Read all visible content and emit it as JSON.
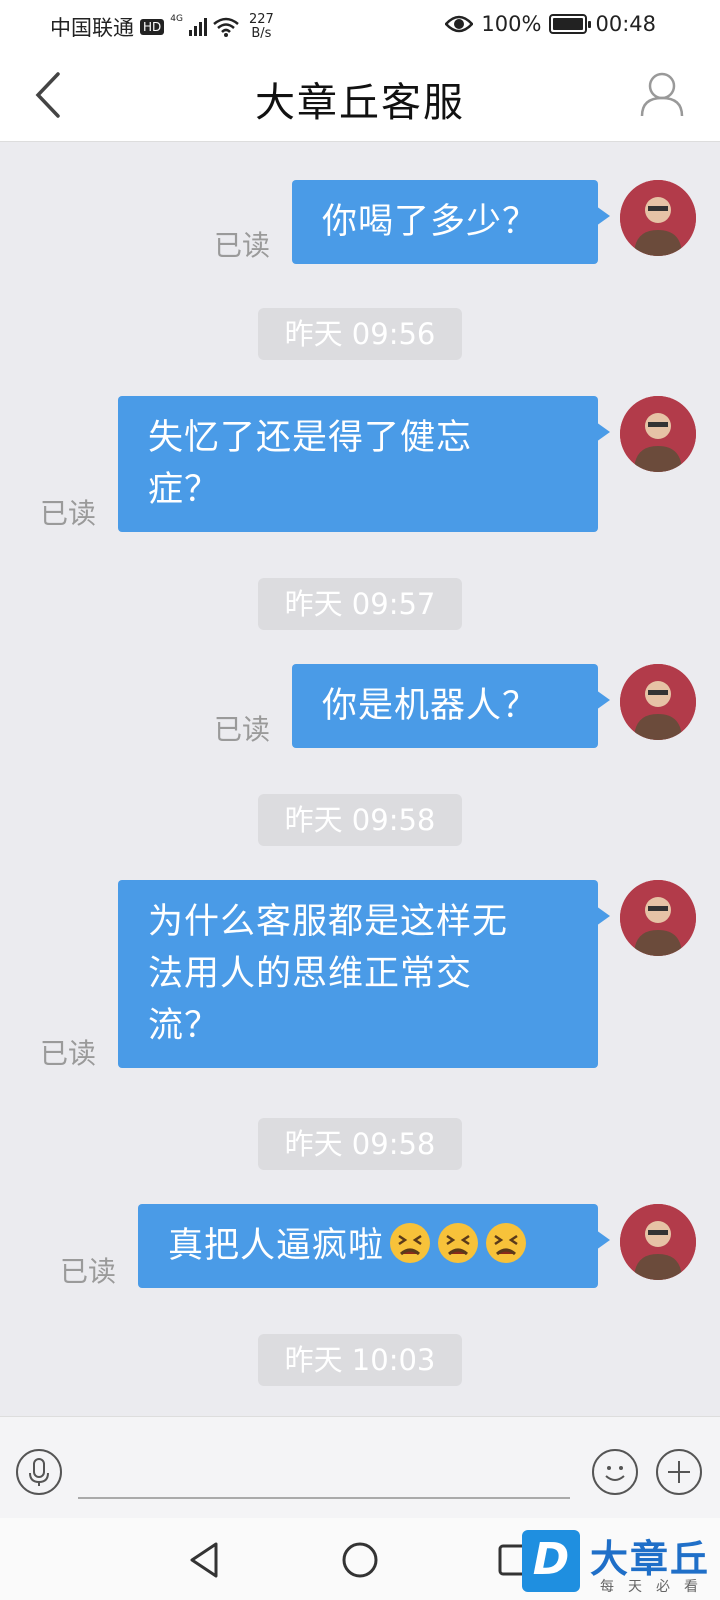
{
  "status_bar": {
    "carrier": "中国联通",
    "hd": "HD",
    "network": "4G",
    "speed_value": "227",
    "speed_unit": "B/s",
    "battery": "100%",
    "time": "00:48",
    "icons": [
      "hd-icon",
      "signal-icon",
      "wifi-icon",
      "eye-icon",
      "battery-icon"
    ]
  },
  "header": {
    "title": "大章丘客服",
    "back_icon": "chevron-left-icon",
    "profile_icon": "person-icon"
  },
  "messages": [
    {
      "text": "你喝了多少？",
      "read": "已读"
    },
    {
      "text": "失忆了还是得了健忘\n症？",
      "read": "已读"
    },
    {
      "text": "你是机器人？",
      "read": "已读"
    },
    {
      "text": "为什么客服都是这样无\n法用人的思维正常交\n流？",
      "read": "已读"
    },
    {
      "text": "真把人逼疯啦",
      "emoji": [
        "tired-face-emoji",
        "tired-face-emoji",
        "tired-face-emoji"
      ],
      "read": "已读"
    }
  ],
  "timestamps": [
    "昨天 09:56",
    "昨天 09:57",
    "昨天 09:58",
    "昨天 09:58",
    "昨天 10:03"
  ],
  "input_bar": {
    "placeholder": "",
    "icons": [
      "microphone-icon",
      "smiley-icon",
      "plus-icon"
    ]
  },
  "nav_bar": {
    "icons": [
      "back-triangle-icon",
      "home-circle-icon",
      "recents-square-icon"
    ]
  },
  "watermark": {
    "title": "大章丘",
    "subtitle": "每天必看",
    "logo_letter": "D"
  },
  "colors": {
    "bubble": "#4a9be7",
    "background": "#ebebef",
    "timestamp_bg": "#dcdcdf"
  }
}
